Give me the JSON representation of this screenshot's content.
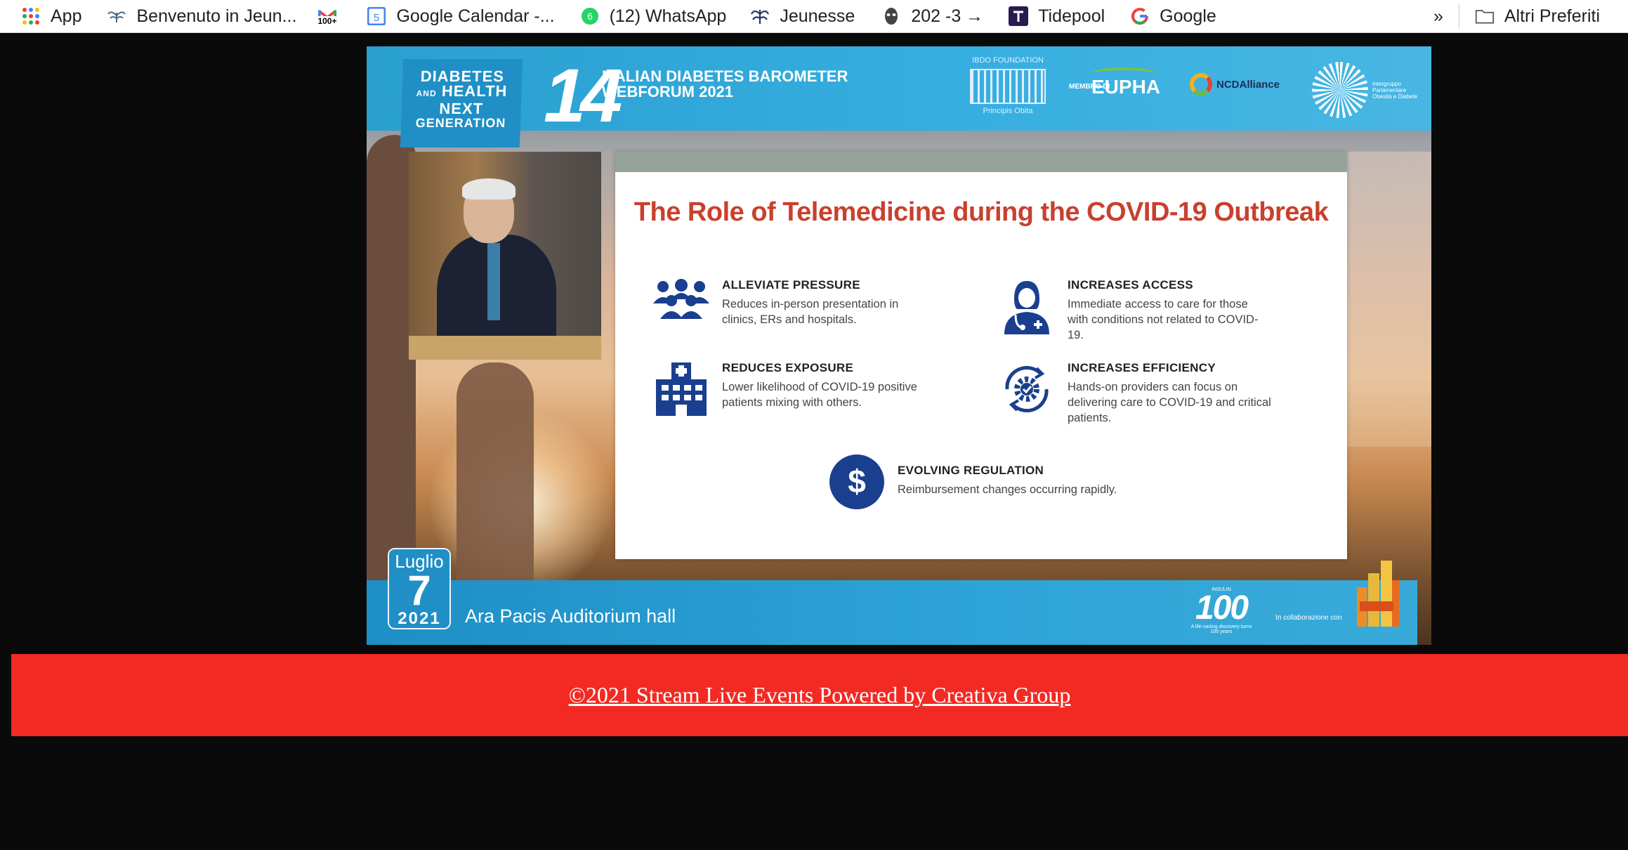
{
  "bookmarks": {
    "items": [
      {
        "label": "App",
        "icon": "apps-grid-icon"
      },
      {
        "label": "Benvenuto in Jeun...",
        "icon": "jeunesse-icon"
      },
      {
        "label": "",
        "icon": "gmail-icon",
        "badge": "100+"
      },
      {
        "label": "Google Calendar -...",
        "icon": "google-calendar-icon",
        "badge": "5"
      },
      {
        "label": "(12) WhatsApp",
        "icon": "whatsapp-icon",
        "badge": "6"
      },
      {
        "label": "Jeunesse",
        "icon": "jeunesse-icon"
      },
      {
        "label": "202 -3 →",
        "icon": "mask-icon"
      },
      {
        "label": "Tidepool",
        "icon": "tidepool-icon"
      },
      {
        "label": "Google",
        "icon": "google-icon"
      }
    ],
    "overflow": "»",
    "other_bookmarks": "Altri Preferiti"
  },
  "video": {
    "banner": {
      "diabetes_line1": "DIABETES",
      "diabetes_line2_small": "AND",
      "diabetes_line2": "HEALTH",
      "diabetes_line3": "NEXT",
      "diabetes_line4": "GENERATION",
      "edition": "14",
      "forum_line1": "ITALIAN DIABETES BAROMETER",
      "forum_line2": "WEBFORUM 2021",
      "ibdo": "IBDO FOUNDATION",
      "ibdo_sub": "Principis Obita",
      "membro": "MEMBRO DI",
      "eupha": "EUPHA",
      "ncd": "NCDAlliance",
      "intergruppo": "Intergruppo Parlamentare Obesità e Diabete"
    },
    "slide": {
      "title": "The Role of Telemedicine during the COVID-19 Outbreak",
      "items": [
        {
          "heading": "ALLEVIATE PRESSURE",
          "desc": "Reduces in-person presentation in clinics, ERs and hospitals.",
          "icon": "people-group-icon"
        },
        {
          "heading": "INCREASES ACCESS",
          "desc": "Immediate access to care for those with conditions not related to COVID-19.",
          "icon": "doctor-icon"
        },
        {
          "heading": "REDUCES EXPOSURE",
          "desc": "Lower likelihood of COVID-19 positive patients mixing with others.",
          "icon": "hospital-icon"
        },
        {
          "heading": "INCREASES EFFICIENCY",
          "desc": "Hands-on providers can focus on delivering care to COVID-19 and critical patients.",
          "icon": "efficiency-gear-icon"
        },
        {
          "heading": "EVOLVING REGULATION",
          "desc": "Reimbursement changes occurring rapidly.",
          "icon": "dollar-icon"
        }
      ]
    },
    "date": {
      "month": "Luglio",
      "day": "7",
      "year": "2021"
    },
    "location": "Ara Pacis Auditorium hall",
    "insulin": {
      "top": "INSULIN",
      "number": "100",
      "tagline": "A life-saving discovery turns 100 years"
    },
    "collab": "In collaborazione con",
    "colors": {
      "banner_blue": "#2a9fd0",
      "title_red": "#c8412e",
      "icon_navy": "#1a3f8f"
    }
  },
  "footer": {
    "link_text": "©2021 Stream Live Events Powered by Creativa Group",
    "background": "#f22a23"
  }
}
